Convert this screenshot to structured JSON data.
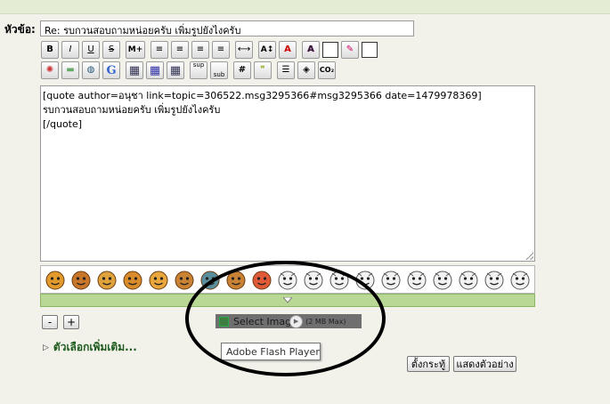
{
  "form": {
    "subject_label": "หัวข้อ:",
    "subject_value": "Re: รบกวนสอบถามหน่อยครับ เพิ่มรูปยังไงครับ"
  },
  "toolbar": {
    "row1": [
      {
        "name": "bold-button",
        "label": "B"
      },
      {
        "name": "italic-button",
        "label": "I"
      },
      {
        "name": "underline-button",
        "label": "U"
      },
      {
        "name": "strikethrough-button",
        "label": "S"
      },
      {
        "name": "more-button",
        "label": "M+"
      },
      {
        "name": "preformatted-button",
        "label": "≡"
      },
      {
        "name": "align-left-button",
        "label": "≡"
      },
      {
        "name": "align-center-button",
        "label": "≡"
      },
      {
        "name": "align-right-button",
        "label": "≡"
      },
      {
        "name": "horizontal-rule-button",
        "label": "⟷"
      },
      {
        "name": "font-size-button",
        "label": "A↕"
      },
      {
        "name": "font-face-button",
        "label": "A"
      },
      {
        "name": "text-color-button",
        "label": "A"
      },
      {
        "name": "highlight-color-button",
        "label": "✎"
      }
    ],
    "row2": [
      {
        "name": "flash-button",
        "label": "✺"
      },
      {
        "name": "image-button",
        "label": "▬"
      },
      {
        "name": "link-button",
        "label": "◍"
      },
      {
        "name": "google-button",
        "label": "G"
      },
      {
        "name": "table-button",
        "label": "▦"
      },
      {
        "name": "table-row-button",
        "label": "▦"
      },
      {
        "name": "table-cell-button",
        "label": "▦"
      },
      {
        "name": "superscript-button",
        "label": "sup"
      },
      {
        "name": "subscript-button",
        "label": "sub"
      },
      {
        "name": "code-button",
        "label": "#"
      },
      {
        "name": "quote-button",
        "label": "❞"
      },
      {
        "name": "list-button",
        "label": "☰"
      },
      {
        "name": "cube-button",
        "label": "◈"
      },
      {
        "name": "co2-button",
        "label": "CO₂"
      }
    ]
  },
  "editor": {
    "lines": [
      "[quote author=อนุชา link=topic=306522.msg3295366#msg3295366 date=1479978369]",
      "รบกวนสอบถามหน่อยครับ เพิ่มรูปยังไงครับ",
      "[/quote]"
    ]
  },
  "smileys": {
    "count": 19,
    "expand_icon": "chevron-down-icon"
  },
  "size_controls": {
    "minus": "-",
    "plus": "+"
  },
  "upload": {
    "button_label": "Select Imag",
    "max_label": "(2 MB Max)",
    "tooltip": "Adobe Flash Player"
  },
  "more_options": {
    "label": "ตัวเลือกเพิ่มเติม..."
  },
  "actions": {
    "post_label": "ตั้งกระทู้",
    "preview_label": "แสดงตัวอย่าง"
  },
  "colors": {
    "green_bar": "#b9d895",
    "link_green": "#1d5a1d",
    "flash_bar": "#6f6f6f"
  }
}
